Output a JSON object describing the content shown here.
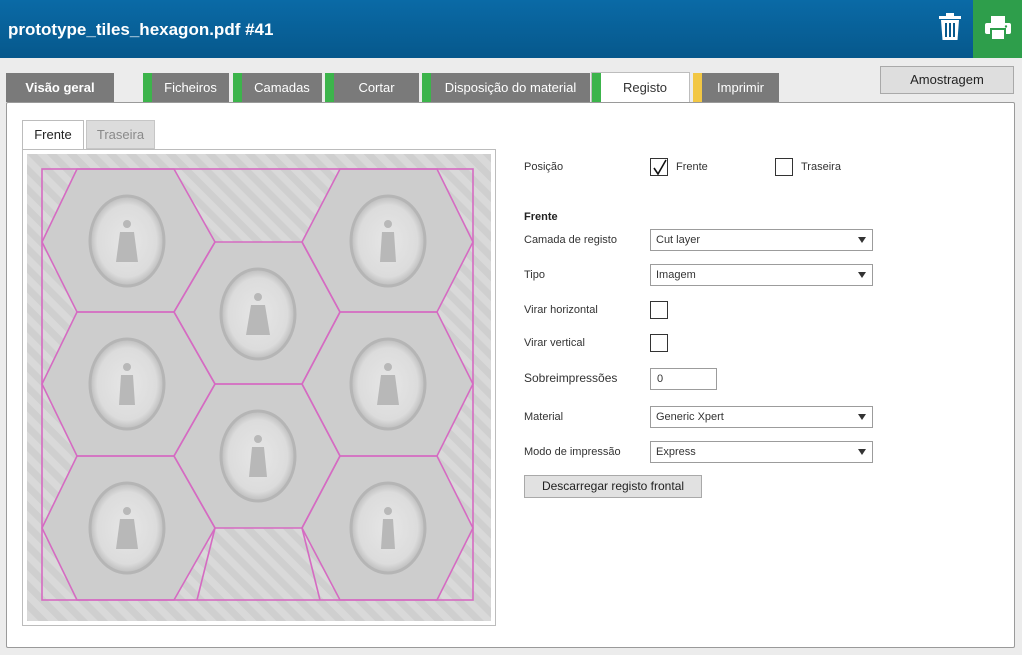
{
  "header": {
    "title": "prototype_tiles_hexagon.pdf #41",
    "trash_icon": "trash-icon",
    "print_icon": "printer-icon",
    "colors": {
      "header_bg": "#06588c",
      "print_bg": "#2e9e4b"
    }
  },
  "tabs": [
    {
      "label": "Visão geral",
      "stripe": ""
    },
    {
      "label": "Ficheiros",
      "stripe": "#3cb44b"
    },
    {
      "label": "Camadas",
      "stripe": "#3cb44b"
    },
    {
      "label": "Cortar",
      "stripe": "#3cb44b"
    },
    {
      "label": "Disposição do material",
      "stripe": "#3cb44b"
    },
    {
      "label": "Registo",
      "stripe": "#3cb44b",
      "active": true
    },
    {
      "label": "Imprimir",
      "stripe": "#f2c744"
    }
  ],
  "sample_button": "Amostragem",
  "preview": {
    "subtabs": [
      "Frente",
      "Traseira"
    ],
    "active_subtab": "Frente"
  },
  "form": {
    "position_label": "Posição",
    "front_label": "Frente",
    "back_label": "Traseira",
    "front_checked": true,
    "back_checked": false,
    "section_title": "Frente",
    "reg_layer_label": "Camada de registo",
    "reg_layer_value": "Cut layer",
    "type_label": "Tipo",
    "type_value": "Imagem",
    "flip_h_label": "Virar horizontal",
    "flip_v_label": "Virar vertical",
    "overprints_label": "Sobreimpressões",
    "overprints_value": "0",
    "material_label": "Material",
    "material_value": "Generic Xpert",
    "print_mode_label": "Modo de impressão",
    "print_mode_value": "Express",
    "download_button": "Descarregar registo frontal"
  }
}
